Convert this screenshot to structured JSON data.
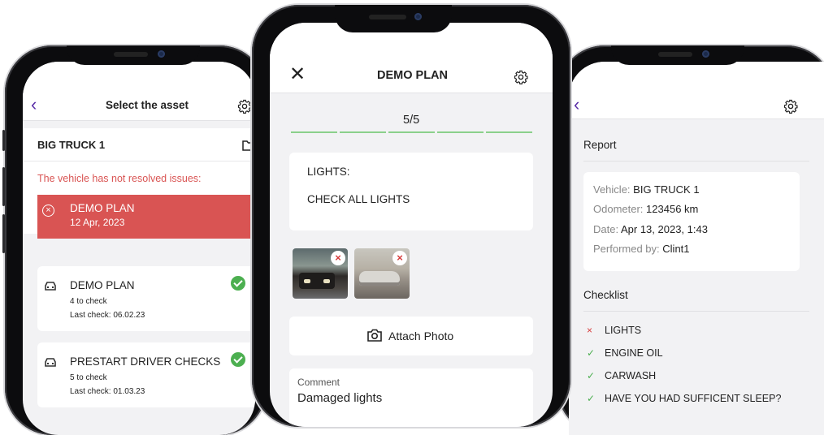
{
  "colors": {
    "accent": "#5b2fa8",
    "danger": "#d95453",
    "success": "#4caf50"
  },
  "left": {
    "header_title": "Select the asset",
    "asset_name": "BIG TRUCK 1",
    "issues_label": "The vehicle has not resolved issues:",
    "issue": {
      "title": "DEMO PLAN",
      "date": "12 Apr, 2023"
    },
    "plans": [
      {
        "title": "DEMO PLAN",
        "count": "4 to check",
        "last": "Last check: 06.02.23"
      },
      {
        "title": "PRESTART DRIVER CHECKS",
        "count": "5 to check",
        "last": "Last check: 01.03.23"
      }
    ],
    "icons": {
      "back": "back-chevron-icon",
      "settings": "gear-icon",
      "folder": "folder-icon",
      "error": "error-circle-icon",
      "vehicle": "car-icon",
      "done": "check-circle-icon"
    }
  },
  "middle": {
    "title": "DEMO PLAN",
    "progress": "5/5",
    "progress_fraction": 1.0,
    "question_title": "LIGHTS:",
    "question_text": "CHECK ALL LIGHTS",
    "attach_label": "Attach Photo",
    "comment_label": "Comment",
    "comment_value": "Damaged lights",
    "icons": {
      "close": "close-icon",
      "settings": "gear-icon",
      "camera": "camera-icon",
      "remove": "remove-photo-icon"
    }
  },
  "right": {
    "report_title": "Report",
    "vehicle_label": "Vehicle:",
    "vehicle_value": "BIG TRUCK 1",
    "odometer_label": "Odometer:",
    "odometer_value": "123456 km",
    "date_label": "Date:",
    "date_value": "Apr 13, 2023, 1:43",
    "performed_label": "Performed by:",
    "performed_value": "Clint1",
    "checklist_title": "Checklist",
    "items": [
      {
        "label": "LIGHTS",
        "status": "fail"
      },
      {
        "label": "ENGINE OIL",
        "status": "pass"
      },
      {
        "label": "CARWASH",
        "status": "pass"
      },
      {
        "label": "HAVE YOU HAD SUFFICENT SLEEP?",
        "status": "pass"
      }
    ],
    "marks": {
      "fail": "×",
      "pass": "✓"
    }
  }
}
